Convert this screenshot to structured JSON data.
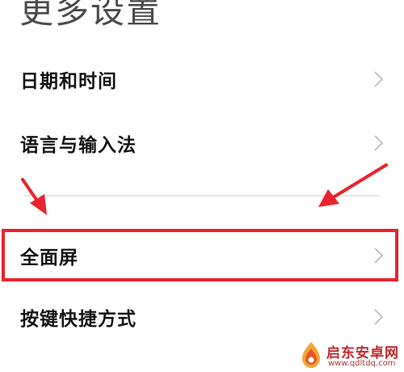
{
  "header": {
    "title": "更多设置"
  },
  "settings": {
    "items": [
      {
        "label": "日期和时间"
      },
      {
        "label": "语言与输入法"
      },
      {
        "label": "全面屏",
        "highlighted": true
      },
      {
        "label": "按键快捷方式"
      }
    ]
  },
  "icons": {
    "row_chevron": "chevron-right-icon",
    "annotation_arrow": "red-arrow-icon"
  },
  "colors": {
    "highlight": "#e8242c",
    "title": "#4a4a4a",
    "label": "#141414",
    "chevron": "#b8b8b8",
    "divider": "#e8e8e8"
  },
  "watermark": {
    "name": "启东安卓网",
    "url": "www.qdltdq.com"
  }
}
